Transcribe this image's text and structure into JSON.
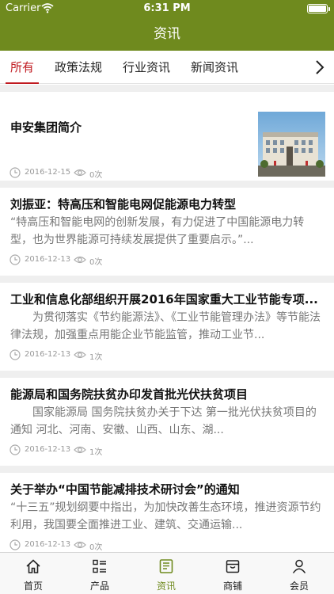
{
  "status_bar": {
    "carrier": "Carrier",
    "time": "6:31 PM"
  },
  "nav": {
    "title": "资讯"
  },
  "tabs": [
    {
      "label": "所有",
      "active": true
    },
    {
      "label": "政策法规",
      "active": false
    },
    {
      "label": "行业资讯",
      "active": false
    },
    {
      "label": "新闻资讯",
      "active": false
    }
  ],
  "articles": [
    {
      "title": "申安集团简介",
      "summary": "",
      "date": "2016-12-15",
      "views": "0次",
      "has_image": true
    },
    {
      "title": "刘振亚：特高压和智能电网促能源电力转型",
      "summary": "“特高压和智能电网的创新发展，有力促进了中国能源电力转型，也为世界能源可持续发展提供了重要启示。”...",
      "date": "2016-12-13",
      "views": "0次"
    },
    {
      "title": "工业和信息化部组织开展2016年国家重大工业节能专项...",
      "summary": "为贯彻落实《节约能源法》、《工业节能管理办法》等节能法律法规，加强重点用能企业节能监管，推动工业节...",
      "date": "2016-12-13",
      "views": "1次"
    },
    {
      "title": "能源局和国务院扶贫办印发首批光伏扶贫项目",
      "summary": "国家能源局 国务院扶贫办关于下达 第一批光伏扶贫项目的通知 河北、河南、安徽、山西、山东、湖...",
      "date": "2016-12-13",
      "views": "1次"
    },
    {
      "title": "关于举办“中国节能减排技术研讨会”的通知",
      "summary": "“十三五”规划纲要中指出，为加快改善生态环境，推进资源节约利用，我国要全面推进工业、建筑、交通运输...",
      "date": "2016-12-13",
      "views": "0次"
    }
  ],
  "tab_bar": [
    {
      "label": "首页",
      "icon": "home-icon"
    },
    {
      "label": "产品",
      "icon": "list-icon"
    },
    {
      "label": "资讯",
      "icon": "news-icon",
      "active": true
    },
    {
      "label": "商铺",
      "icon": "store-icon"
    },
    {
      "label": "会员",
      "icon": "user-icon"
    }
  ],
  "colors": {
    "primary": "#6f8a1e",
    "active_tab": "#c0191f",
    "summary_text": "#777777"
  }
}
